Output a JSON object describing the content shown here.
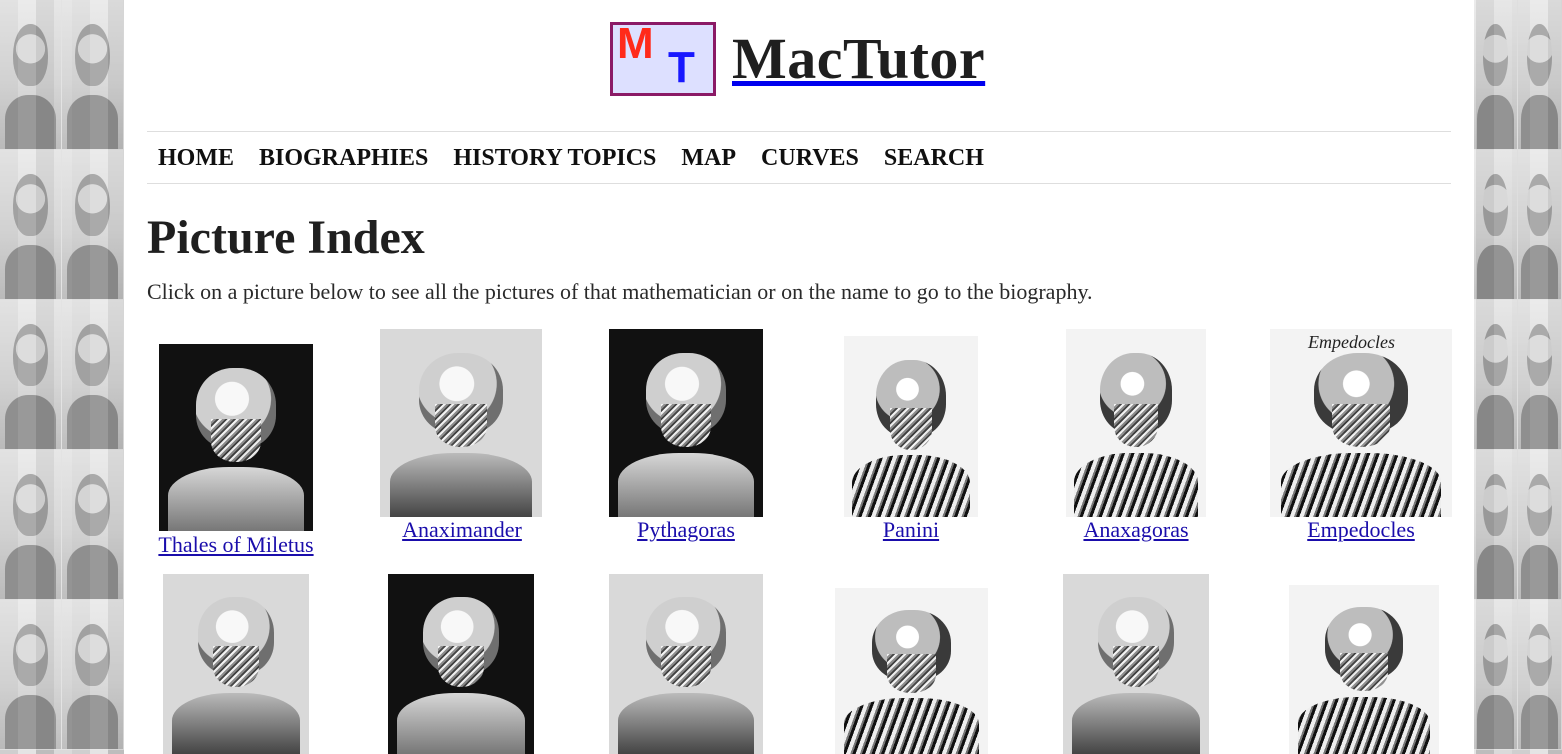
{
  "site": {
    "title": "MacTutor",
    "logo_letters": [
      "M",
      "T"
    ],
    "colors": {
      "logo_border": "#8b1a66",
      "logo_background": "#dde0ff",
      "logo_m": "#ff2a1a",
      "logo_t": "#1818ff",
      "link": "#1a0dab"
    }
  },
  "nav": {
    "items": [
      "HOME",
      "BIOGRAPHIES",
      "HISTORY TOPICS",
      "MAP",
      "CURVES",
      "SEARCH"
    ]
  },
  "main": {
    "title": "Picture Index",
    "description": "Click on a picture below to see all the pictures of that mathematician or on the name to go to the biography.",
    "pictures": [
      {
        "name": "Thales of Miletus",
        "image_icon": "portrait-thales-icon"
      },
      {
        "name": "Anaximander",
        "image_icon": "portrait-anaximander-icon"
      },
      {
        "name": "Pythagoras",
        "image_icon": "portrait-pythagoras-icon"
      },
      {
        "name": "Panini",
        "image_icon": "portrait-panini-icon"
      },
      {
        "name": "Anaxagoras",
        "image_icon": "portrait-anaxagoras-icon"
      },
      {
        "name": "Empedocles",
        "image_icon": "portrait-empedocles-icon",
        "image_text": "Empedocles"
      },
      {
        "name": "",
        "image_icon": "portrait-icon"
      },
      {
        "name": "",
        "image_icon": "portrait-icon"
      },
      {
        "name": "",
        "image_icon": "portrait-icon"
      },
      {
        "name": "",
        "image_icon": "portrait-icon"
      },
      {
        "name": "",
        "image_icon": "portrait-icon"
      },
      {
        "name": "",
        "image_icon": "portrait-icon"
      }
    ]
  },
  "decorative_background": {
    "icon": "portrait-collage-icon"
  }
}
